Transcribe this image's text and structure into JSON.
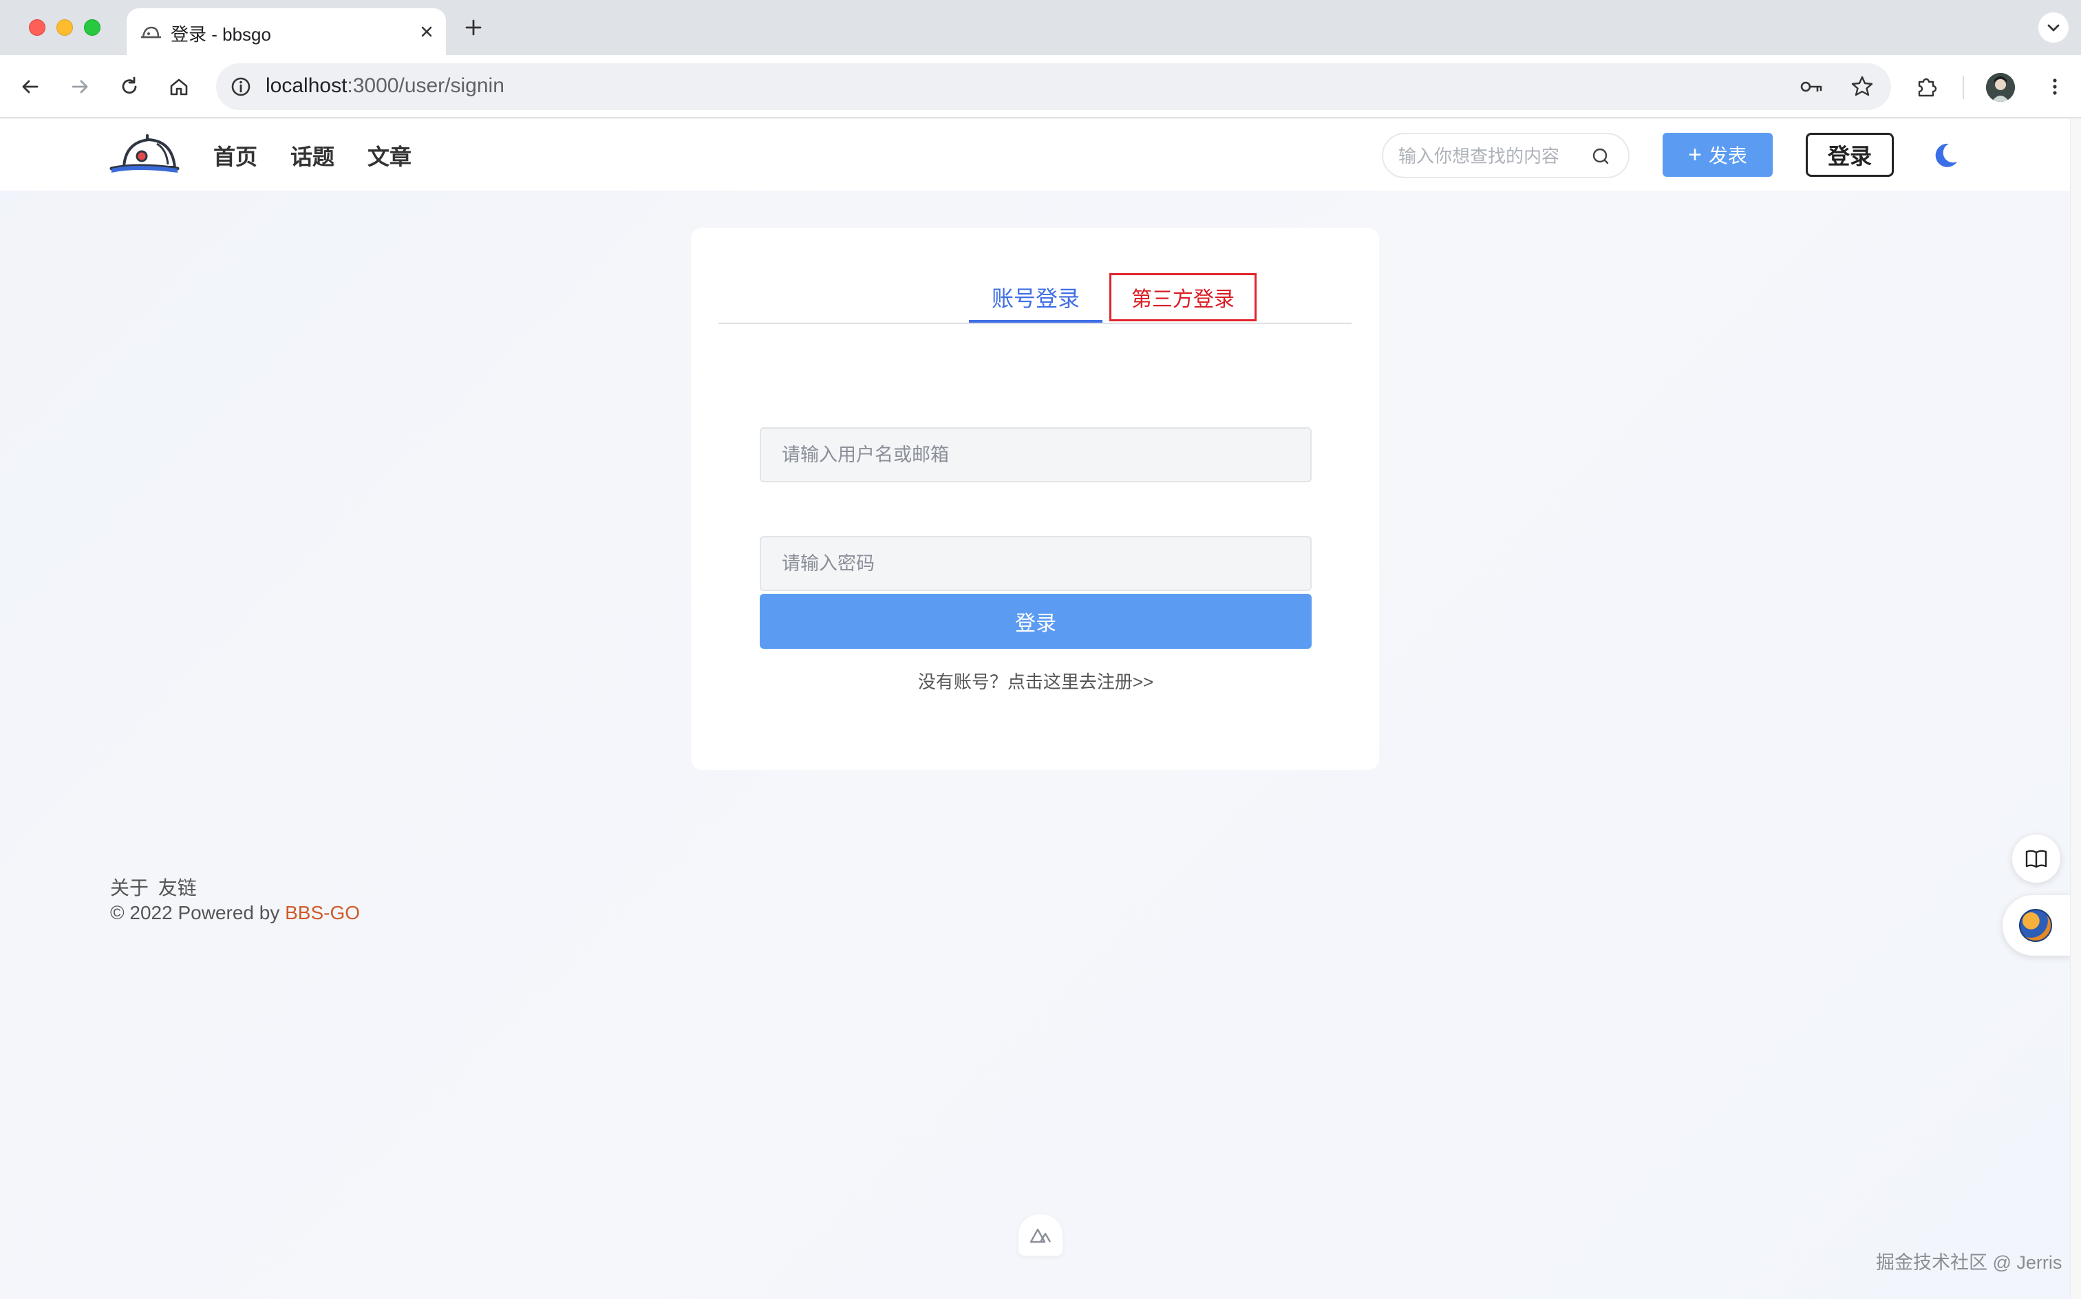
{
  "browser": {
    "tab_title": "登录 - bbsgo",
    "url_host": "localhost",
    "url_path": ":3000/user/signin"
  },
  "header": {
    "nav": [
      "首页",
      "话题",
      "文章"
    ],
    "search_placeholder": "输入你想查找的内容",
    "publish_label": "发表",
    "login_label": "登录"
  },
  "login": {
    "tab_account": "账号登录",
    "tab_third_party": "第三方登录",
    "username_placeholder": "请输入用户名或邮箱",
    "password_placeholder": "请输入密码",
    "submit_label": "登录",
    "register_text": "没有账号？点击这里去注册>>"
  },
  "footer": {
    "about": "关于",
    "links": "友链",
    "copyright": "© 2022 Powered by ",
    "brand": "BBS-GO"
  },
  "watermark": "掘金技术社区 @ Jerris",
  "colors": {
    "primary": "#5b9cf2",
    "tab_active": "#3f6ee6",
    "highlight_box": "#e1242c",
    "brand_link": "#d05b2a"
  }
}
